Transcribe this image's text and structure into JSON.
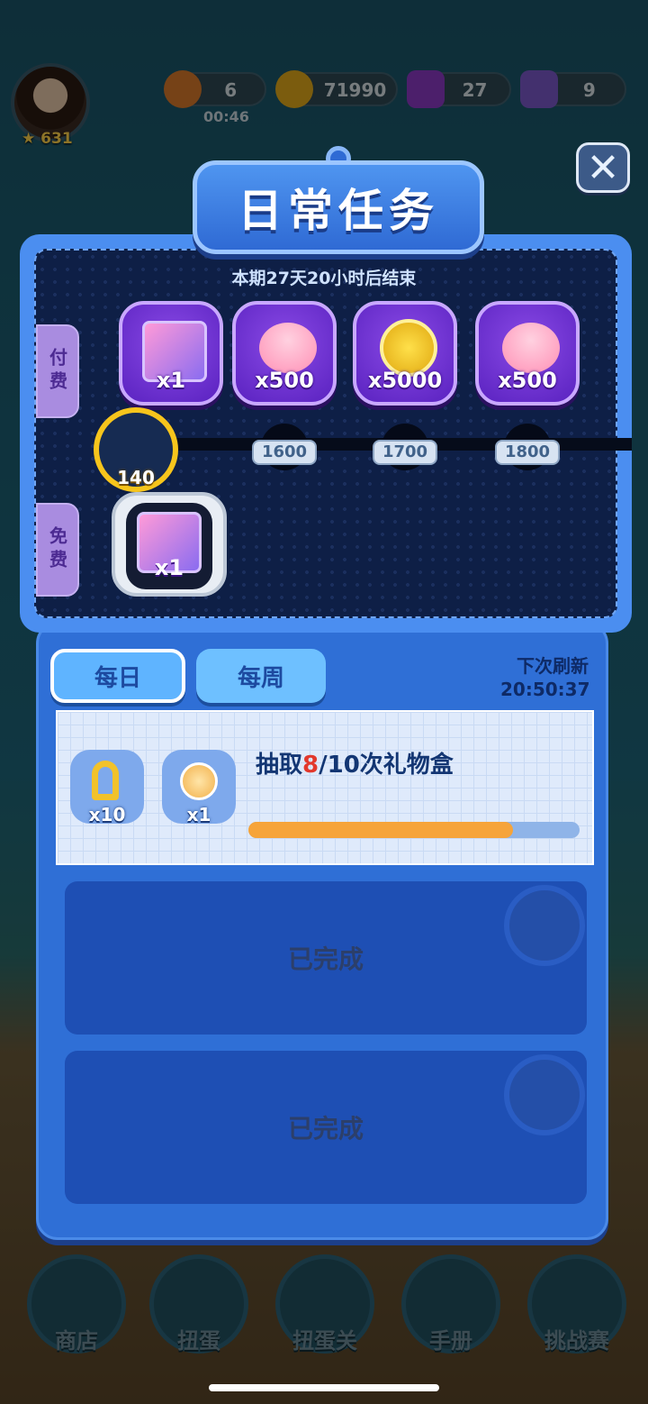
{
  "top": {
    "level": "631",
    "energy": "6",
    "energy_timer": "00:46",
    "coins": "71990",
    "gems": "27",
    "crowns": "9"
  },
  "dialog": {
    "title": "日常任务",
    "period": "本期27天20小时后结束",
    "close_label": "✕"
  },
  "track": {
    "paid_label": "付费",
    "free_label": "免费",
    "paid_rewards": [
      {
        "icon": "gift-box-icon",
        "qty": "x1"
      },
      {
        "icon": "heart-icon",
        "qty": "x500"
      },
      {
        "icon": "coin-icon",
        "qty": "x5000"
      },
      {
        "icon": "heart-icon",
        "qty": "x500"
      }
    ],
    "current_keys": "140",
    "milestones": [
      "1600",
      "1700",
      "1800"
    ],
    "free_reward": {
      "icon": "gift-box-icon",
      "qty": "x1"
    }
  },
  "tabs": {
    "daily": "每日",
    "weekly": "每周"
  },
  "refresh": {
    "label": "下次刷新",
    "time": "20:50:37"
  },
  "task": {
    "prefix": "抽取",
    "done": "8",
    "suffix": "/10次礼物盒",
    "progress": 0.8,
    "rewards": [
      {
        "icon": "key-icon",
        "qty": "x10"
      },
      {
        "icon": "cake-icon",
        "qty": "x1"
      }
    ]
  },
  "completed": [
    "已完成",
    "已完成"
  ],
  "nav": [
    "商店",
    "扭蛋",
    "扭蛋关",
    "手册",
    "挑战赛"
  ],
  "colors": {
    "accent": "#2f6fd6",
    "progress": "#f6a43a",
    "highlight": "#e2382c"
  }
}
